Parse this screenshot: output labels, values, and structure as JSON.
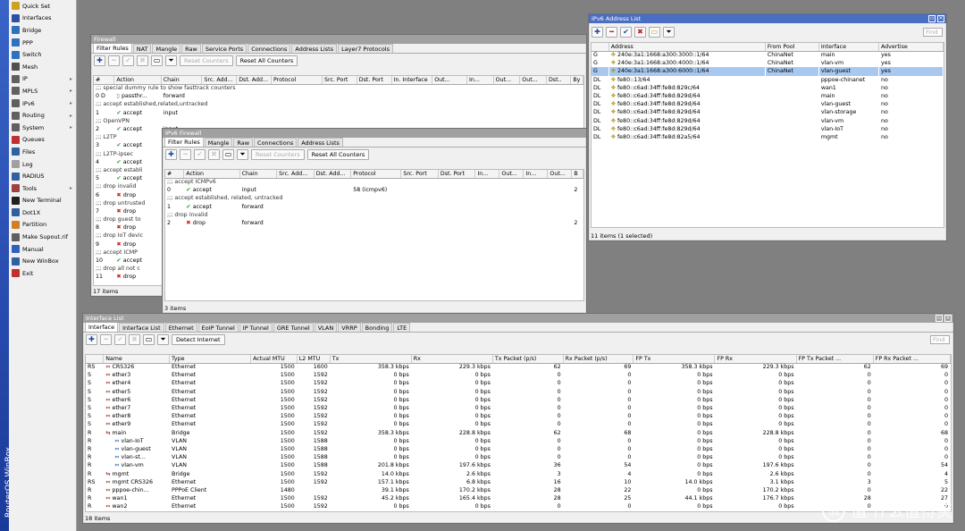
{
  "app": {
    "side_title": "RouterOS WinBox"
  },
  "menu": [
    {
      "label": "Quick Set",
      "icon": "quick-set-icon",
      "color": "#d0a020",
      "arrow": false
    },
    {
      "label": "Interfaces",
      "icon": "interfaces-icon",
      "color": "#3050a0",
      "arrow": false
    },
    {
      "label": "Bridge",
      "icon": "bridge-icon",
      "color": "#3070c0",
      "arrow": false
    },
    {
      "label": "PPP",
      "icon": "ppp-icon",
      "color": "#3070c0",
      "arrow": false
    },
    {
      "label": "Switch",
      "icon": "switch-icon",
      "color": "#3070c0",
      "arrow": false
    },
    {
      "label": "Mesh",
      "icon": "mesh-icon",
      "color": "#505050",
      "arrow": false
    },
    {
      "label": "IP",
      "icon": "ip-icon",
      "color": "#606060",
      "arrow": true
    },
    {
      "label": "MPLS",
      "icon": "mpls-icon",
      "color": "#606060",
      "arrow": true
    },
    {
      "label": "IPv6",
      "icon": "ipv6-icon",
      "color": "#606060",
      "arrow": true
    },
    {
      "label": "Routing",
      "icon": "routing-icon",
      "color": "#606060",
      "arrow": true
    },
    {
      "label": "System",
      "icon": "system-icon",
      "color": "#606060",
      "arrow": true
    },
    {
      "label": "Queues",
      "icon": "queues-icon",
      "color": "#c03030",
      "arrow": false
    },
    {
      "label": "Files",
      "icon": "files-icon",
      "color": "#3060a0",
      "arrow": false
    },
    {
      "label": "Log",
      "icon": "log-icon",
      "color": "#a0a0a0",
      "arrow": false
    },
    {
      "label": "RADIUS",
      "icon": "radius-icon",
      "color": "#3060a0",
      "arrow": false
    },
    {
      "label": "Tools",
      "icon": "tools-icon",
      "color": "#a04040",
      "arrow": true
    },
    {
      "label": "New Terminal",
      "icon": "terminal-icon",
      "color": "#202020",
      "arrow": false
    },
    {
      "label": "Dot1X",
      "icon": "dot1x-icon",
      "color": "#3060a0",
      "arrow": false
    },
    {
      "label": "Partition",
      "icon": "partition-icon",
      "color": "#d08020",
      "arrow": false
    },
    {
      "label": "Make Supout.rif",
      "icon": "supout-icon",
      "color": "#606060",
      "arrow": false
    },
    {
      "label": "Manual",
      "icon": "manual-icon",
      "color": "#3060c0",
      "arrow": false
    },
    {
      "label": "New WinBox",
      "icon": "winbox-icon",
      "color": "#3060a0",
      "arrow": false
    },
    {
      "label": "Exit",
      "icon": "exit-icon",
      "color": "#c03030",
      "arrow": false
    }
  ],
  "firewall": {
    "title": "Firewall",
    "tabs": [
      "Filter Rules",
      "NAT",
      "Mangle",
      "Raw",
      "Service Ports",
      "Connections",
      "Address Lists",
      "Layer7 Protocols"
    ],
    "reset_counters": "Reset Counters",
    "reset_all": "Reset All Counters",
    "columns": [
      "#",
      "Action",
      "Chain",
      "Src. Add...",
      "Dst. Add...",
      "Protocol",
      "Src. Port",
      "Dst. Port",
      "In. Interface",
      "Out...",
      "In...",
      "Out...",
      "Out...",
      "Dst..",
      "By"
    ],
    "rows": [
      {
        "comment": ";;; special dummy rule to show fasttrack counters"
      },
      {
        "num": "0 D",
        "icon": "pass",
        "action": "passthr...",
        "chain": "forward"
      },
      {
        "comment": ";;; accept established,related,untracked"
      },
      {
        "num": "1",
        "icon": "ok",
        "action": "accept",
        "chain": "input"
      },
      {
        "comment": ";;; OpenVPN"
      },
      {
        "num": "2",
        "icon": "ok",
        "action": "accept",
        "chain": "input"
      },
      {
        "comment": ";;; L2TP"
      },
      {
        "num": "3",
        "icon": "ok",
        "action": "accept",
        "chain": "input"
      },
      {
        "comment": ";;; L2TP-ipsec"
      },
      {
        "num": "4",
        "icon": "ok",
        "action": "accept",
        "chain": "input"
      },
      {
        "comment": ";;; accept establi"
      },
      {
        "num": "5",
        "icon": "ok",
        "action": "accept",
        "chain": ""
      },
      {
        "comment": ";;; drop invalid"
      },
      {
        "num": "6",
        "icon": "x",
        "action": "drop",
        "chain": ""
      },
      {
        "comment": ";;; drop untrusted"
      },
      {
        "num": "7",
        "icon": "x",
        "action": "drop",
        "chain": ""
      },
      {
        "comment": ";;; drop guest to"
      },
      {
        "num": "8",
        "icon": "x",
        "action": "drop",
        "chain": ""
      },
      {
        "comment": ";;; drop IoT devic"
      },
      {
        "num": "9",
        "icon": "x",
        "action": "drop",
        "chain": ""
      },
      {
        "comment": ";;; accept ICMP"
      },
      {
        "num": "10",
        "icon": "ok",
        "action": "accept",
        "chain": ""
      },
      {
        "comment": ";;; drop all not c"
      },
      {
        "num": "11",
        "icon": "x",
        "action": "drop",
        "chain": ""
      }
    ],
    "status": "17 items"
  },
  "ipv6fw": {
    "title": "IPv6 Firewall",
    "tabs": [
      "Filter Rules",
      "Mangle",
      "Raw",
      "Connections",
      "Address Lists"
    ],
    "reset_counters": "Reset Counters",
    "reset_all": "Reset All Counters",
    "columns": [
      "#",
      "Action",
      "Chain",
      "Src. Add...",
      "Dst. Add...",
      "Protocol",
      "Src. Port",
      "Dst. Port",
      "In...",
      "Out...",
      "In...",
      "Out...",
      "B"
    ],
    "rows": [
      {
        "comment": ";;; accept ICMPv6"
      },
      {
        "num": "0",
        "icon": "ok",
        "action": "accept",
        "chain": "input",
        "proto": "58 (icmpv6)",
        "b": "2"
      },
      {
        "comment": ";;; accept established, related, untracked"
      },
      {
        "num": "1",
        "icon": "ok",
        "action": "accept",
        "chain": "forward",
        "proto": "",
        "b": ""
      },
      {
        "comment": ";;; drop invalid"
      },
      {
        "num": "2",
        "icon": "x",
        "action": "drop",
        "chain": "forward",
        "proto": "",
        "b": "2"
      }
    ],
    "status": "3 items"
  },
  "addrlist": {
    "title": "IPv6 Address List",
    "find": "Find",
    "columns": [
      "",
      "Address",
      "From Pool",
      "Interface",
      "Advertise"
    ],
    "rows": [
      {
        "flag": "G",
        "addr": "240e:3a1:1668:a300:3000::1/64",
        "pool": "ChinaNet",
        "iface": "main",
        "adv": "yes",
        "sel": false
      },
      {
        "flag": "G",
        "addr": "240e:3a1:1668:a300:4000::1/64",
        "pool": "ChinaNet",
        "iface": "vlan-vm",
        "adv": "yes",
        "sel": false
      },
      {
        "flag": "G",
        "addr": "240e:3a1:1668:a300:6000::1/64",
        "pool": "ChinaNet",
        "iface": "vlan-guest",
        "adv": "yes",
        "sel": true
      },
      {
        "flag": "DL",
        "addr": "fe80::13/64",
        "pool": "",
        "iface": "pppoe-chinanet",
        "adv": "no",
        "sel": false
      },
      {
        "flag": "DL",
        "addr": "fe80::c6ad:34ff:fe8d:829c/64",
        "pool": "",
        "iface": "wan1",
        "adv": "no",
        "sel": false
      },
      {
        "flag": "DL",
        "addr": "fe80::c6ad:34ff:fe8d:829d/64",
        "pool": "",
        "iface": "main",
        "adv": "no",
        "sel": false
      },
      {
        "flag": "DL",
        "addr": "fe80::c6ad:34ff:fe8d:829d/64",
        "pool": "",
        "iface": "vlan-guest",
        "adv": "no",
        "sel": false
      },
      {
        "flag": "DL",
        "addr": "fe80::c6ad:34ff:fe8d:829d/64",
        "pool": "",
        "iface": "vlan-storage",
        "adv": "no",
        "sel": false
      },
      {
        "flag": "DL",
        "addr": "fe80::c6ad:34ff:fe8d:829d/64",
        "pool": "",
        "iface": "vlan-vm",
        "adv": "no",
        "sel": false
      },
      {
        "flag": "DL",
        "addr": "fe80::c6ad:34ff:fe8d:829d/64",
        "pool": "",
        "iface": "vlan-IoT",
        "adv": "no",
        "sel": false
      },
      {
        "flag": "DL",
        "addr": "fe80::c6ad:34ff:fe8d:82a5/64",
        "pool": "",
        "iface": "mgmt",
        "adv": "no",
        "sel": false
      }
    ],
    "status": "11 items (1 selected)"
  },
  "iflist": {
    "title": "Interface List",
    "tabs": [
      "Interface",
      "Interface List",
      "Ethernet",
      "EoIP Tunnel",
      "IP Tunnel",
      "GRE Tunnel",
      "VLAN",
      "VRRP",
      "Bonding",
      "LTE"
    ],
    "detect": "Detect Internet",
    "find": "Find",
    "columns": [
      "",
      "Name",
      "Type",
      "Actual MTU",
      "L2 MTU",
      "Tx",
      "Rx",
      "Tx Packet (p/s)",
      "Rx Packet (p/s)",
      "FP Tx",
      "FP Rx",
      "FP Tx Packet ...",
      "FP Rx Packet ..."
    ],
    "rows": [
      {
        "f": "RS",
        "name": "CRS326",
        "ind": 0,
        "type": "Ethernet",
        "mtu": "1500",
        "l2": "1600",
        "tx": "358.3 kbps",
        "rx": "229.3 kbps",
        "txp": "62",
        "rxp": "69",
        "fptx": "358.3 kbps",
        "fprx": "229.3 kbps",
        "fptxp": "62",
        "fprxp": "69"
      },
      {
        "f": "S",
        "name": "ether3",
        "ind": 0,
        "type": "Ethernet",
        "mtu": "1500",
        "l2": "1592",
        "tx": "0 bps",
        "rx": "0 bps",
        "txp": "0",
        "rxp": "0",
        "fptx": "0 bps",
        "fprx": "0 bps",
        "fptxp": "0",
        "fprxp": "0"
      },
      {
        "f": "S",
        "name": "ether4",
        "ind": 0,
        "type": "Ethernet",
        "mtu": "1500",
        "l2": "1592",
        "tx": "0 bps",
        "rx": "0 bps",
        "txp": "0",
        "rxp": "0",
        "fptx": "0 bps",
        "fprx": "0 bps",
        "fptxp": "0",
        "fprxp": "0"
      },
      {
        "f": "S",
        "name": "ether5",
        "ind": 0,
        "type": "Ethernet",
        "mtu": "1500",
        "l2": "1592",
        "tx": "0 bps",
        "rx": "0 bps",
        "txp": "0",
        "rxp": "0",
        "fptx": "0 bps",
        "fprx": "0 bps",
        "fptxp": "0",
        "fprxp": "0"
      },
      {
        "f": "S",
        "name": "ether6",
        "ind": 0,
        "type": "Ethernet",
        "mtu": "1500",
        "l2": "1592",
        "tx": "0 bps",
        "rx": "0 bps",
        "txp": "0",
        "rxp": "0",
        "fptx": "0 bps",
        "fprx": "0 bps",
        "fptxp": "0",
        "fprxp": "0"
      },
      {
        "f": "S",
        "name": "ether7",
        "ind": 0,
        "type": "Ethernet",
        "mtu": "1500",
        "l2": "1592",
        "tx": "0 bps",
        "rx": "0 bps",
        "txp": "0",
        "rxp": "0",
        "fptx": "0 bps",
        "fprx": "0 bps",
        "fptxp": "0",
        "fprxp": "0"
      },
      {
        "f": "S",
        "name": "ether8",
        "ind": 0,
        "type": "Ethernet",
        "mtu": "1500",
        "l2": "1592",
        "tx": "0 bps",
        "rx": "0 bps",
        "txp": "0",
        "rxp": "0",
        "fptx": "0 bps",
        "fprx": "0 bps",
        "fptxp": "0",
        "fprxp": "0"
      },
      {
        "f": "S",
        "name": "ether9",
        "ind": 0,
        "type": "Ethernet",
        "mtu": "1500",
        "l2": "1592",
        "tx": "0 bps",
        "rx": "0 bps",
        "txp": "0",
        "rxp": "0",
        "fptx": "0 bps",
        "fprx": "0 bps",
        "fptxp": "0",
        "fprxp": "0"
      },
      {
        "f": "R",
        "name": "main",
        "ind": 0,
        "type": "Bridge",
        "mtu": "1500",
        "l2": "1592",
        "tx": "358.3 kbps",
        "rx": "228.8 kbps",
        "txp": "62",
        "rxp": "68",
        "fptx": "0 bps",
        "fprx": "228.8 kbps",
        "fptxp": "0",
        "fprxp": "68"
      },
      {
        "f": "R",
        "name": "vlan-IoT",
        "ind": 1,
        "type": "VLAN",
        "mtu": "1500",
        "l2": "1588",
        "tx": "0 bps",
        "rx": "0 bps",
        "txp": "0",
        "rxp": "0",
        "fptx": "0 bps",
        "fprx": "0 bps",
        "fptxp": "0",
        "fprxp": "0"
      },
      {
        "f": "R",
        "name": "vlan-guest",
        "ind": 1,
        "type": "VLAN",
        "mtu": "1500",
        "l2": "1588",
        "tx": "0 bps",
        "rx": "0 bps",
        "txp": "0",
        "rxp": "0",
        "fptx": "0 bps",
        "fprx": "0 bps",
        "fptxp": "0",
        "fprxp": "0"
      },
      {
        "f": "R",
        "name": "vlan-st...",
        "ind": 1,
        "type": "VLAN",
        "mtu": "1500",
        "l2": "1588",
        "tx": "0 bps",
        "rx": "0 bps",
        "txp": "0",
        "rxp": "0",
        "fptx": "0 bps",
        "fprx": "0 bps",
        "fptxp": "0",
        "fprxp": "0"
      },
      {
        "f": "R",
        "name": "vlan-vm",
        "ind": 1,
        "type": "VLAN",
        "mtu": "1500",
        "l2": "1588",
        "tx": "201.8 kbps",
        "rx": "197.6 kbps",
        "txp": "36",
        "rxp": "54",
        "fptx": "0 bps",
        "fprx": "197.6 kbps",
        "fptxp": "0",
        "fprxp": "54"
      },
      {
        "f": "R",
        "name": "mgmt",
        "ind": 0,
        "type": "Bridge",
        "mtu": "1500",
        "l2": "1592",
        "tx": "14.0 kbps",
        "rx": "2.6 kbps",
        "txp": "3",
        "rxp": "4",
        "fptx": "0 bps",
        "fprx": "2.6 kbps",
        "fptxp": "0",
        "fprxp": "4"
      },
      {
        "f": "RS",
        "name": "mgmt CRS326",
        "ind": 0,
        "type": "Ethernet",
        "mtu": "1500",
        "l2": "1592",
        "tx": "157.1 kbps",
        "rx": "6.8 kbps",
        "txp": "16",
        "rxp": "10",
        "fptx": "14.0 kbps",
        "fprx": "3.1 kbps",
        "fptxp": "3",
        "fprxp": "5"
      },
      {
        "f": "R",
        "name": "pppoe-chin...",
        "ind": 0,
        "type": "PPPoE Client",
        "mtu": "1480",
        "l2": "",
        "tx": "39.1 kbps",
        "rx": "170.2 kbps",
        "txp": "28",
        "rxp": "22",
        "fptx": "0 bps",
        "fprx": "170.2 kbps",
        "fptxp": "0",
        "fprxp": "22"
      },
      {
        "f": "R",
        "name": "wan1",
        "ind": 0,
        "type": "Ethernet",
        "mtu": "1500",
        "l2": "1592",
        "tx": "45.2 kbps",
        "rx": "165.4 kbps",
        "txp": "28",
        "rxp": "25",
        "fptx": "44.1 kbps",
        "fprx": "176.7 kbps",
        "fptxp": "28",
        "fprxp": "27"
      },
      {
        "f": "R",
        "name": "wan2",
        "ind": 0,
        "type": "Ethernet",
        "mtu": "1500",
        "l2": "1592",
        "tx": "0 bps",
        "rx": "0 bps",
        "txp": "0",
        "rxp": "0",
        "fptx": "0 bps",
        "fprx": "0 bps",
        "fptxp": "0",
        "fprxp": "0"
      }
    ],
    "status": "18 items"
  },
  "watermark": "值 什么值得买"
}
